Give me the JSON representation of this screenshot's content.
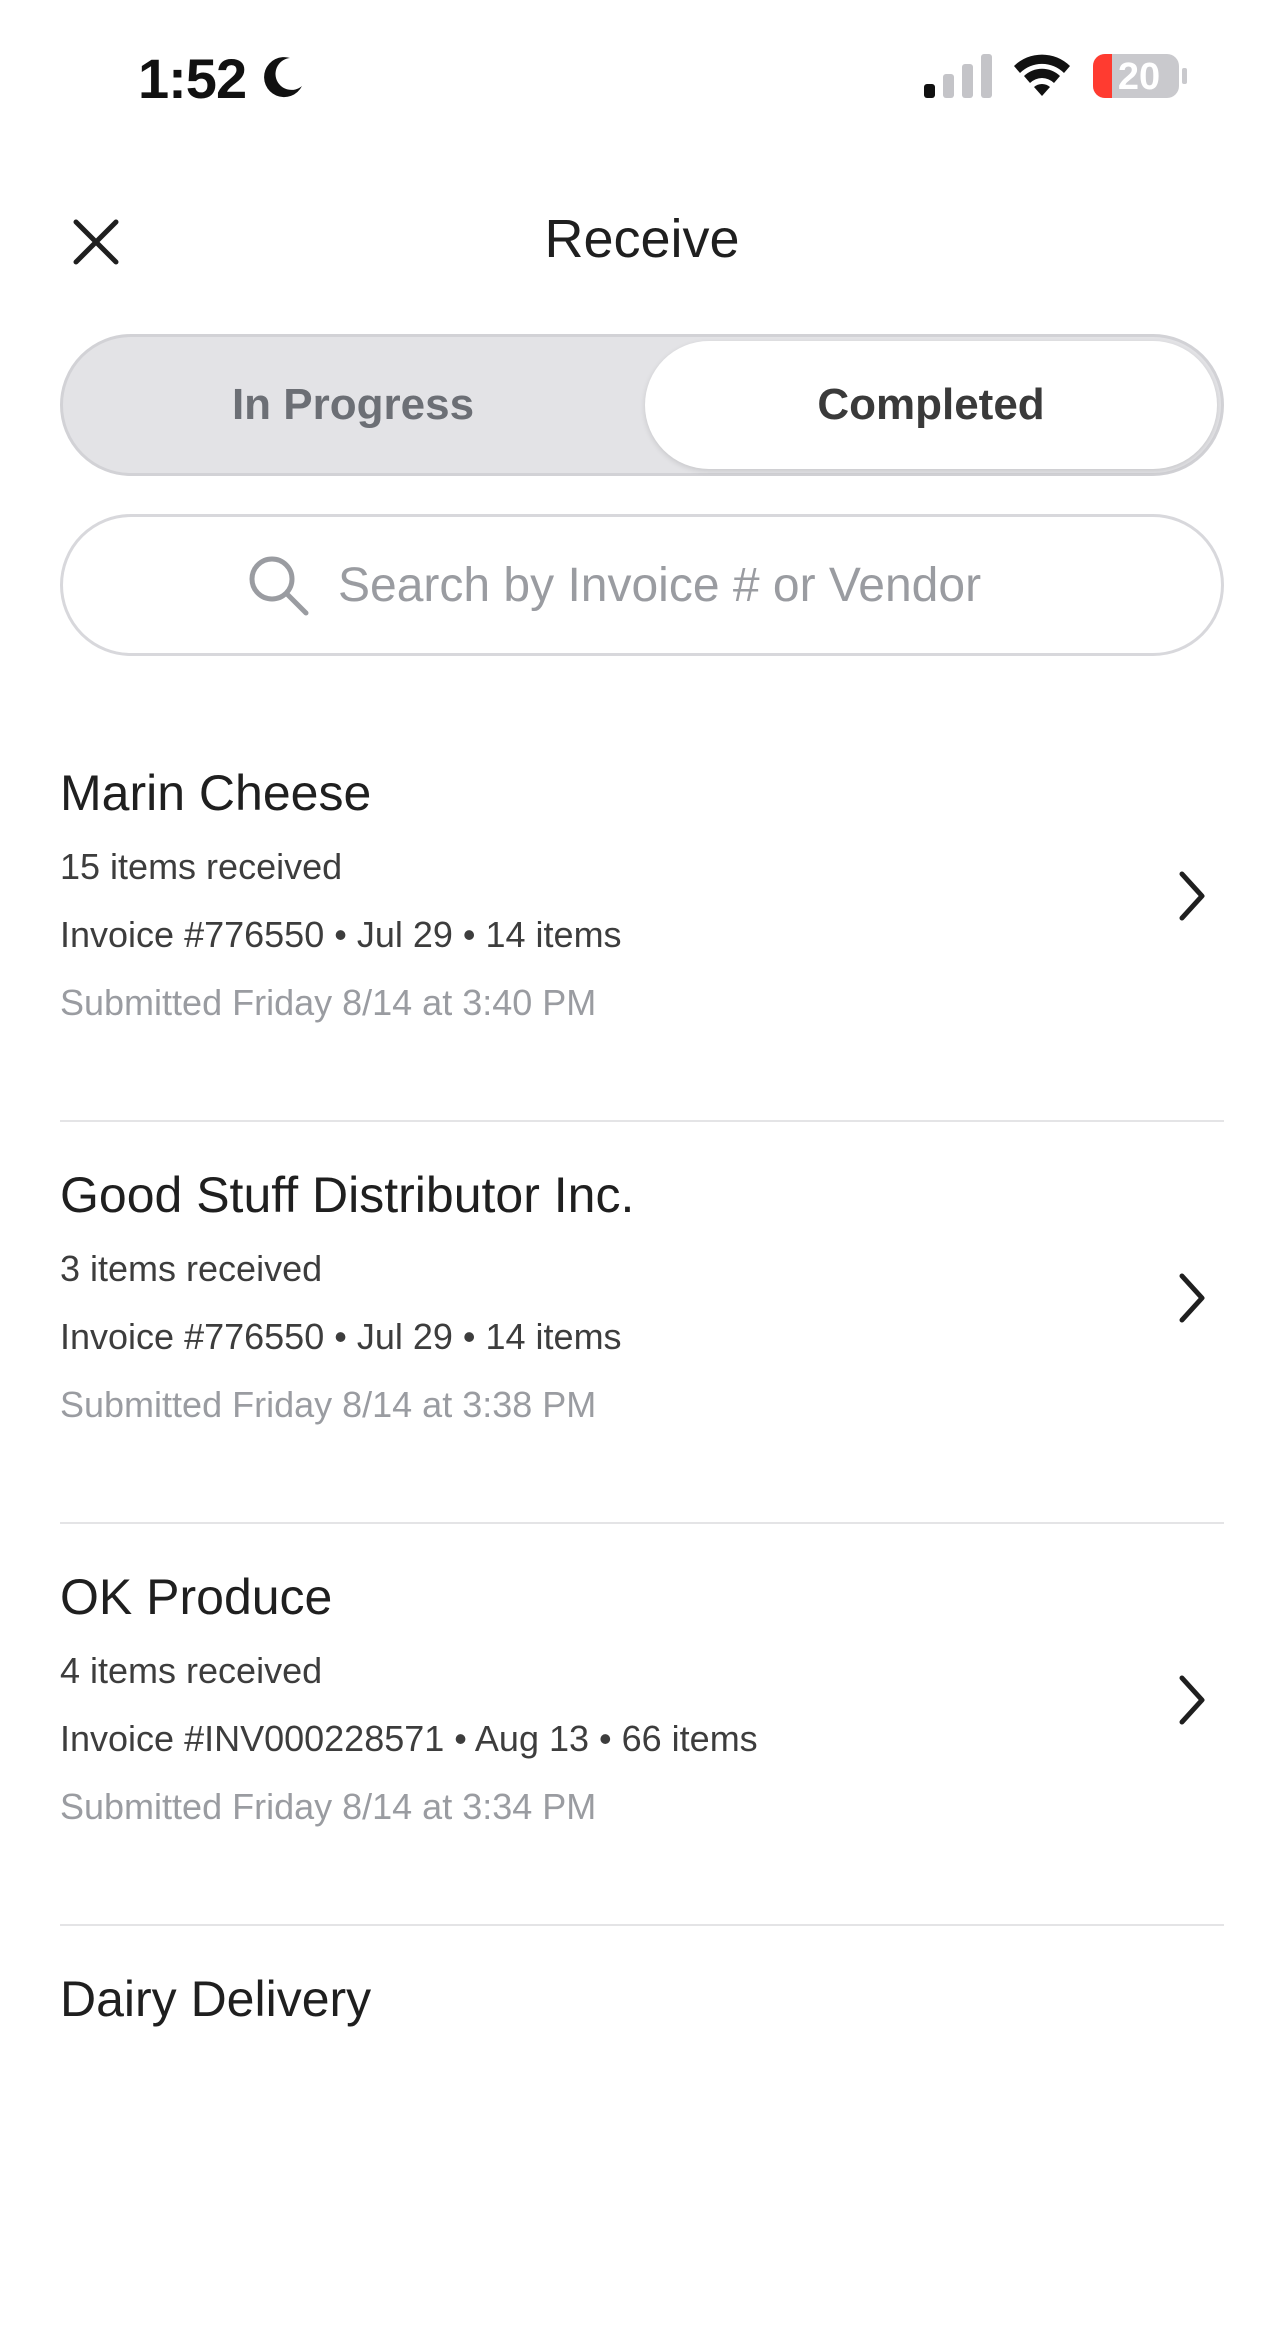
{
  "status_bar": {
    "time": "1:52",
    "battery_level": "20",
    "icons": [
      "moon-icon",
      "cellular-signal-icon",
      "wifi-icon",
      "battery-icon"
    ]
  },
  "header": {
    "title": "Receive",
    "close_icon": "close-icon"
  },
  "tabs": [
    {
      "label": "In Progress",
      "selected": false
    },
    {
      "label": "Completed",
      "selected": true
    }
  ],
  "search": {
    "placeholder": "Search by Invoice # or Vendor",
    "value": "",
    "icon": "search-icon"
  },
  "receipts": [
    {
      "vendor": "Marin Cheese",
      "received": "15 items received",
      "invoice": "Invoice #776550 • Jul 29 • 14 items",
      "submitted": "Submitted Friday 8/14 at 3:40 PM"
    },
    {
      "vendor": "Good Stuff Distributor Inc.",
      "received": "3 items received",
      "invoice": "Invoice #776550 • Jul 29 • 14 items",
      "submitted": "Submitted Friday 8/14 at 3:38 PM"
    },
    {
      "vendor": "OK Produce",
      "received": "4 items received",
      "invoice": "Invoice #INV000228571 • Aug 13 • 66 items",
      "submitted": "Submitted Friday 8/14 at 3:34 PM"
    },
    {
      "vendor": "Dairy Delivery"
    }
  ],
  "colors": {
    "segment_bg": "#e3e3e6",
    "selected_segment": "#ffffff",
    "muted_text": "#9a9ca1",
    "battery_low": "#ff3b30"
  }
}
